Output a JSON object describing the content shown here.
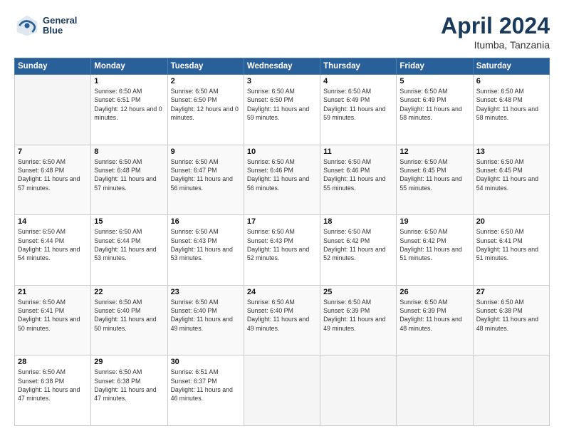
{
  "header": {
    "logo_line1": "General",
    "logo_line2": "Blue",
    "month": "April 2024",
    "location": "Itumba, Tanzania"
  },
  "weekdays": [
    "Sunday",
    "Monday",
    "Tuesday",
    "Wednesday",
    "Thursday",
    "Friday",
    "Saturday"
  ],
  "weeks": [
    [
      {
        "day": "",
        "sunrise": "",
        "sunset": "",
        "daylight": ""
      },
      {
        "day": "1",
        "sunrise": "Sunrise: 6:50 AM",
        "sunset": "Sunset: 6:51 PM",
        "daylight": "Daylight: 12 hours and 0 minutes."
      },
      {
        "day": "2",
        "sunrise": "Sunrise: 6:50 AM",
        "sunset": "Sunset: 6:50 PM",
        "daylight": "Daylight: 12 hours and 0 minutes."
      },
      {
        "day": "3",
        "sunrise": "Sunrise: 6:50 AM",
        "sunset": "Sunset: 6:50 PM",
        "daylight": "Daylight: 11 hours and 59 minutes."
      },
      {
        "day": "4",
        "sunrise": "Sunrise: 6:50 AM",
        "sunset": "Sunset: 6:49 PM",
        "daylight": "Daylight: 11 hours and 59 minutes."
      },
      {
        "day": "5",
        "sunrise": "Sunrise: 6:50 AM",
        "sunset": "Sunset: 6:49 PM",
        "daylight": "Daylight: 11 hours and 58 minutes."
      },
      {
        "day": "6",
        "sunrise": "Sunrise: 6:50 AM",
        "sunset": "Sunset: 6:48 PM",
        "daylight": "Daylight: 11 hours and 58 minutes."
      }
    ],
    [
      {
        "day": "7",
        "sunrise": "Sunrise: 6:50 AM",
        "sunset": "Sunset: 6:48 PM",
        "daylight": "Daylight: 11 hours and 57 minutes."
      },
      {
        "day": "8",
        "sunrise": "Sunrise: 6:50 AM",
        "sunset": "Sunset: 6:48 PM",
        "daylight": "Daylight: 11 hours and 57 minutes."
      },
      {
        "day": "9",
        "sunrise": "Sunrise: 6:50 AM",
        "sunset": "Sunset: 6:47 PM",
        "daylight": "Daylight: 11 hours and 56 minutes."
      },
      {
        "day": "10",
        "sunrise": "Sunrise: 6:50 AM",
        "sunset": "Sunset: 6:46 PM",
        "daylight": "Daylight: 11 hours and 56 minutes."
      },
      {
        "day": "11",
        "sunrise": "Sunrise: 6:50 AM",
        "sunset": "Sunset: 6:46 PM",
        "daylight": "Daylight: 11 hours and 55 minutes."
      },
      {
        "day": "12",
        "sunrise": "Sunrise: 6:50 AM",
        "sunset": "Sunset: 6:45 PM",
        "daylight": "Daylight: 11 hours and 55 minutes."
      },
      {
        "day": "13",
        "sunrise": "Sunrise: 6:50 AM",
        "sunset": "Sunset: 6:45 PM",
        "daylight": "Daylight: 11 hours and 54 minutes."
      }
    ],
    [
      {
        "day": "14",
        "sunrise": "Sunrise: 6:50 AM",
        "sunset": "Sunset: 6:44 PM",
        "daylight": "Daylight: 11 hours and 54 minutes."
      },
      {
        "day": "15",
        "sunrise": "Sunrise: 6:50 AM",
        "sunset": "Sunset: 6:44 PM",
        "daylight": "Daylight: 11 hours and 53 minutes."
      },
      {
        "day": "16",
        "sunrise": "Sunrise: 6:50 AM",
        "sunset": "Sunset: 6:43 PM",
        "daylight": "Daylight: 11 hours and 53 minutes."
      },
      {
        "day": "17",
        "sunrise": "Sunrise: 6:50 AM",
        "sunset": "Sunset: 6:43 PM",
        "daylight": "Daylight: 11 hours and 52 minutes."
      },
      {
        "day": "18",
        "sunrise": "Sunrise: 6:50 AM",
        "sunset": "Sunset: 6:42 PM",
        "daylight": "Daylight: 11 hours and 52 minutes."
      },
      {
        "day": "19",
        "sunrise": "Sunrise: 6:50 AM",
        "sunset": "Sunset: 6:42 PM",
        "daylight": "Daylight: 11 hours and 51 minutes."
      },
      {
        "day": "20",
        "sunrise": "Sunrise: 6:50 AM",
        "sunset": "Sunset: 6:41 PM",
        "daylight": "Daylight: 11 hours and 51 minutes."
      }
    ],
    [
      {
        "day": "21",
        "sunrise": "Sunrise: 6:50 AM",
        "sunset": "Sunset: 6:41 PM",
        "daylight": "Daylight: 11 hours and 50 minutes."
      },
      {
        "day": "22",
        "sunrise": "Sunrise: 6:50 AM",
        "sunset": "Sunset: 6:40 PM",
        "daylight": "Daylight: 11 hours and 50 minutes."
      },
      {
        "day": "23",
        "sunrise": "Sunrise: 6:50 AM",
        "sunset": "Sunset: 6:40 PM",
        "daylight": "Daylight: 11 hours and 49 minutes."
      },
      {
        "day": "24",
        "sunrise": "Sunrise: 6:50 AM",
        "sunset": "Sunset: 6:40 PM",
        "daylight": "Daylight: 11 hours and 49 minutes."
      },
      {
        "day": "25",
        "sunrise": "Sunrise: 6:50 AM",
        "sunset": "Sunset: 6:39 PM",
        "daylight": "Daylight: 11 hours and 49 minutes."
      },
      {
        "day": "26",
        "sunrise": "Sunrise: 6:50 AM",
        "sunset": "Sunset: 6:39 PM",
        "daylight": "Daylight: 11 hours and 48 minutes."
      },
      {
        "day": "27",
        "sunrise": "Sunrise: 6:50 AM",
        "sunset": "Sunset: 6:38 PM",
        "daylight": "Daylight: 11 hours and 48 minutes."
      }
    ],
    [
      {
        "day": "28",
        "sunrise": "Sunrise: 6:50 AM",
        "sunset": "Sunset: 6:38 PM",
        "daylight": "Daylight: 11 hours and 47 minutes."
      },
      {
        "day": "29",
        "sunrise": "Sunrise: 6:50 AM",
        "sunset": "Sunset: 6:38 PM",
        "daylight": "Daylight: 11 hours and 47 minutes."
      },
      {
        "day": "30",
        "sunrise": "Sunrise: 6:51 AM",
        "sunset": "Sunset: 6:37 PM",
        "daylight": "Daylight: 11 hours and 46 minutes."
      },
      {
        "day": "",
        "sunrise": "",
        "sunset": "",
        "daylight": ""
      },
      {
        "day": "",
        "sunrise": "",
        "sunset": "",
        "daylight": ""
      },
      {
        "day": "",
        "sunrise": "",
        "sunset": "",
        "daylight": ""
      },
      {
        "day": "",
        "sunrise": "",
        "sunset": "",
        "daylight": ""
      }
    ]
  ]
}
